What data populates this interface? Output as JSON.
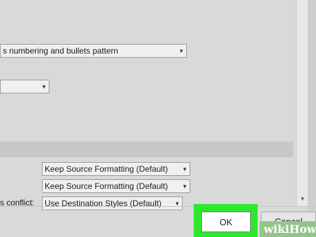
{
  "dialog": {
    "numbering_dropdown": {
      "value": "s numbering and bullets pattern"
    },
    "blank_dropdown": {
      "value": ""
    },
    "paste_rows": [
      {
        "label": "",
        "value": "Keep Source Formatting (Default)"
      },
      {
        "label": "",
        "value": "Keep Source Formatting (Default)"
      },
      {
        "label": "s conflict:",
        "value": "Use Destination Styles (Default)"
      }
    ]
  },
  "buttons": {
    "ok_label": "OK",
    "cancel_label": "Cancel"
  },
  "watermark": {
    "text": "wikiHow"
  },
  "colors": {
    "highlight": "#2ee82e",
    "watermark_bg": "#93c58a",
    "dialog_bg": "#d9d9d9"
  },
  "icons": {
    "dropdown_arrow": "chevron-down-icon",
    "scroll_down": "scroll-down-arrow-icon"
  }
}
